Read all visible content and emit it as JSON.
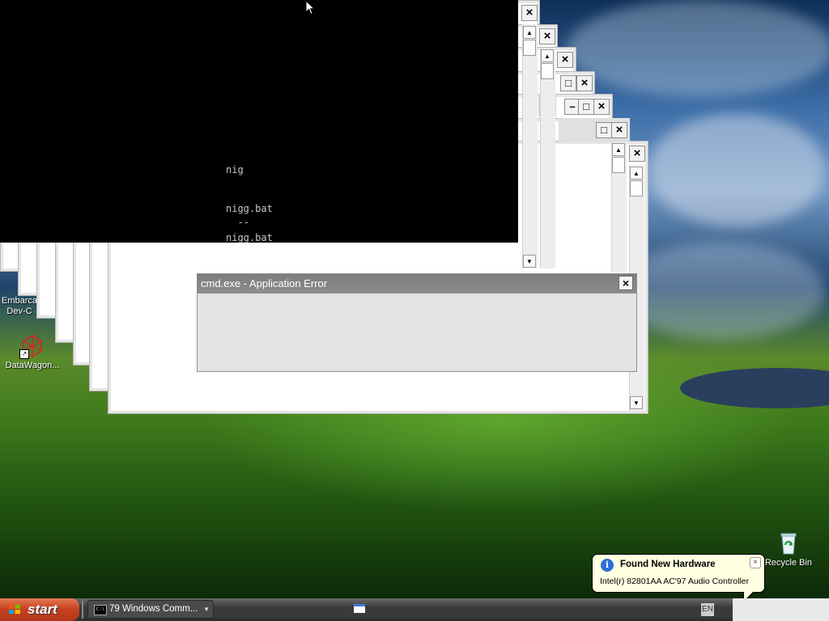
{
  "console": {
    "lines": [
      "nig",
      "nigg.bat",
      "  --",
      "nigg.bat"
    ]
  },
  "error_dialog": {
    "title": "cmd.exe - Application Error",
    "close_glyph": "×"
  },
  "desktop_icons": [
    {
      "label": "Embarcadero Dev-C++",
      "display": "Embarca\nDev-C",
      "icon": "dev-cpp-icon"
    },
    {
      "label": "DataWagon...",
      "icon": "datawagon-icon"
    },
    {
      "label": "Recycle Bin",
      "icon": "recycle-bin-icon"
    }
  ],
  "window_controls": {
    "close_glyph": "×",
    "minimize_glyph": "–",
    "maximize_glyph": "□",
    "up_arrow": "▲",
    "down_arrow": "▼"
  },
  "balloon": {
    "title": "Found New Hardware",
    "text": "Intel(r) 82801AA AC'97 Audio Controller",
    "icon": "info-icon",
    "close_glyph": "×"
  },
  "taskbar": {
    "start_label": "start",
    "task_button_label": "79 Windows Comm...",
    "task_icon_text": "C:\\",
    "language": "EN"
  },
  "colors": {
    "start_button": "#c8421f",
    "console_bg": "#000000",
    "balloon_bg": "#ffffe1",
    "dialog_title_bar": "#8e8e8e"
  }
}
